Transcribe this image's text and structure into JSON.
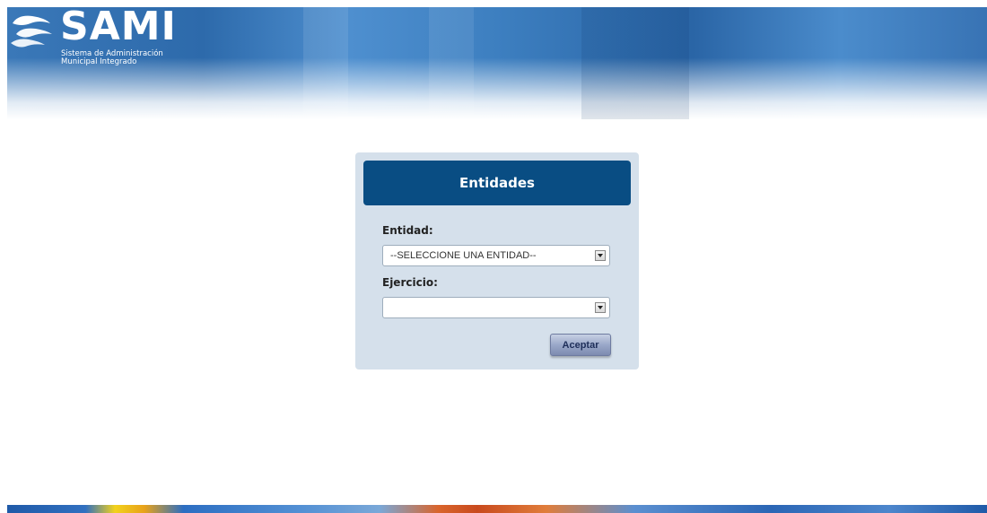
{
  "header": {
    "logo_text": "SAMI",
    "subtitle_line1": "Sistema de Administración",
    "subtitle_line2": "Municipal Integrado"
  },
  "panel": {
    "title": "Entidades",
    "entidad_label": "Entidad:",
    "entidad_value": "--SELECCIONE UNA ENTIDAD--",
    "ejercicio_label": "Ejercicio:",
    "ejercicio_value": "",
    "submit_label": "Aceptar"
  },
  "colors": {
    "panel_header": "#094d83",
    "panel_bg": "#d5e0eb",
    "header_blue": "#3a78b8"
  }
}
